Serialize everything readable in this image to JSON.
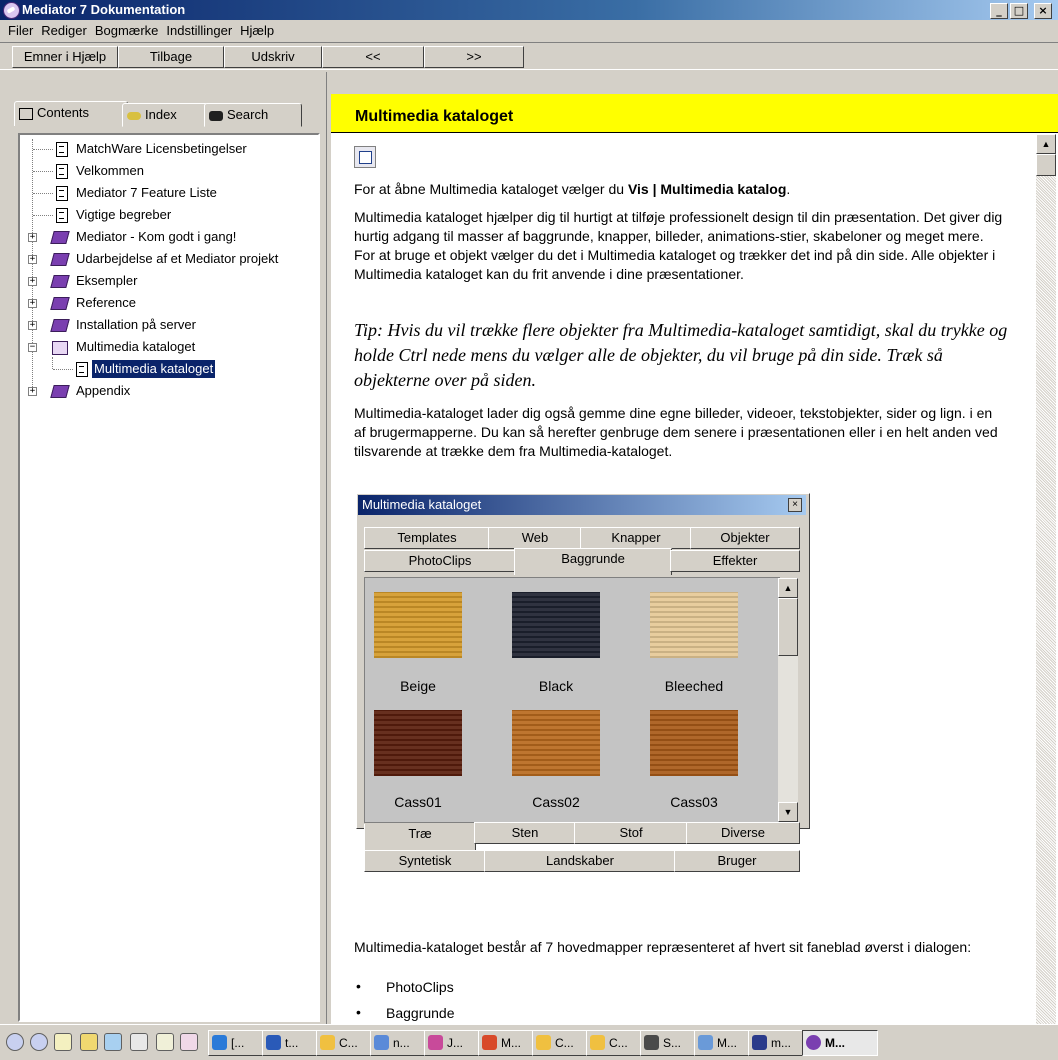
{
  "window": {
    "title": "Mediator 7 Dokumentation",
    "min": "_",
    "max": "□",
    "close": "×"
  },
  "menu": [
    "Filer",
    "Rediger",
    "Bogmærke",
    "Indstillinger",
    "Hjælp"
  ],
  "toolbar": {
    "b1": "Emner i Hjælp",
    "b2": "Tilbage",
    "b3": "Udskriv",
    "b4": "<<",
    "b5": ">>"
  },
  "tabs": {
    "contents": "Contents",
    "index": "Index",
    "search": "Search"
  },
  "tree": [
    {
      "label": "MatchWare Licensbetingelser",
      "icon": "page-icon"
    },
    {
      "label": "Velkommen",
      "icon": "page-icon"
    },
    {
      "label": "Mediator 7 Feature Liste",
      "icon": "page-icon"
    },
    {
      "label": "Vigtige begreber",
      "icon": "page-icon"
    },
    {
      "label": "Mediator - Kom godt i gang!",
      "icon": "book-icon"
    },
    {
      "label": "Udarbejdelse af et Mediator projekt",
      "icon": "book-icon"
    },
    {
      "label": "Eksempler",
      "icon": "book-icon"
    },
    {
      "label": "Reference",
      "icon": "book-icon"
    },
    {
      "label": "Installation på server",
      "icon": "book-icon"
    },
    {
      "label": "Multimedia kataloget",
      "icon": "open-book-icon"
    },
    {
      "label": "Multimedia kataloget",
      "icon": "page-icon",
      "selected": true
    },
    {
      "label": "Appendix",
      "icon": "book-icon"
    }
  ],
  "topic": {
    "title": "Multimedia kataloget",
    "p1a": "For at åbne Multimedia kataloget vælger du ",
    "p1b": "Vis | Multimedia katalog",
    "p1c": ".",
    "p2": "Multimedia kataloget hjælper dig til hurtigt at tilføje professionelt design til din præsentation. Det giver dig hurtig adgang til masser af baggrunde, knapper, billeder, animations-stier, skabeloner og meget mere. For at bruge et objekt vælger du det i Multimedia kataloget og trækker det ind på din side. Alle objekter i Multimedia kataloget kan du frit anvende i dine præsentationer.",
    "tip": "Tip: Hvis du vil trække flere objekter fra Multimedia-kataloget samtidigt, skal du trykke og holde Ctrl nede mens du vælger alle de objekter, du vil bruge på din side. Træk så objekterne over på siden.",
    "p3": "Multimedia-kataloget lader dig også gemme dine egne billeder, videoer, tekstobjekter, sider og lign. i en af brugermapperne. Du kan så herefter genbruge dem senere i præsentationen eller i en helt anden ved tilsvarende at trække dem fra Multimedia-kataloget.",
    "p4": "Multimedia-kataloget består af 7 hovedmapper repræsenteret af hvert sit faneblad øverst i dialogen:",
    "bullets": [
      "PhotoClips",
      "Baggrunde"
    ],
    "bullet_char": "•"
  },
  "dialog": {
    "title": "Multimedia kataloget",
    "close": "×",
    "tabs_row1": [
      "Templates",
      "Web",
      "Knapper",
      "Objekter"
    ],
    "tabs_row2": [
      "PhotoClips",
      "Baggrunde",
      "Effekter"
    ],
    "items": [
      {
        "label": "Beige",
        "color": "#d49a2a"
      },
      {
        "label": "Black",
        "color": "#1e2230"
      },
      {
        "label": "Bleeched",
        "color": "#e6c996"
      },
      {
        "label": "Cass01",
        "color": "#5a1e0c"
      },
      {
        "label": "Cass02",
        "color": "#b86a1e"
      },
      {
        "label": "Cass03",
        "color": "#a85a18"
      }
    ],
    "bottom_row1": [
      "Træ",
      "Sten",
      "Stof",
      "Diverse"
    ],
    "bottom_row2": [
      "Syntetisk",
      "Landskaber",
      "Bruger"
    ]
  },
  "taskbar": {
    "items": [
      "[...",
      "t...",
      "C...",
      "n...",
      "J...",
      "M...",
      "C...",
      "C...",
      "S...",
      "M...",
      "m...",
      "M..."
    ]
  }
}
